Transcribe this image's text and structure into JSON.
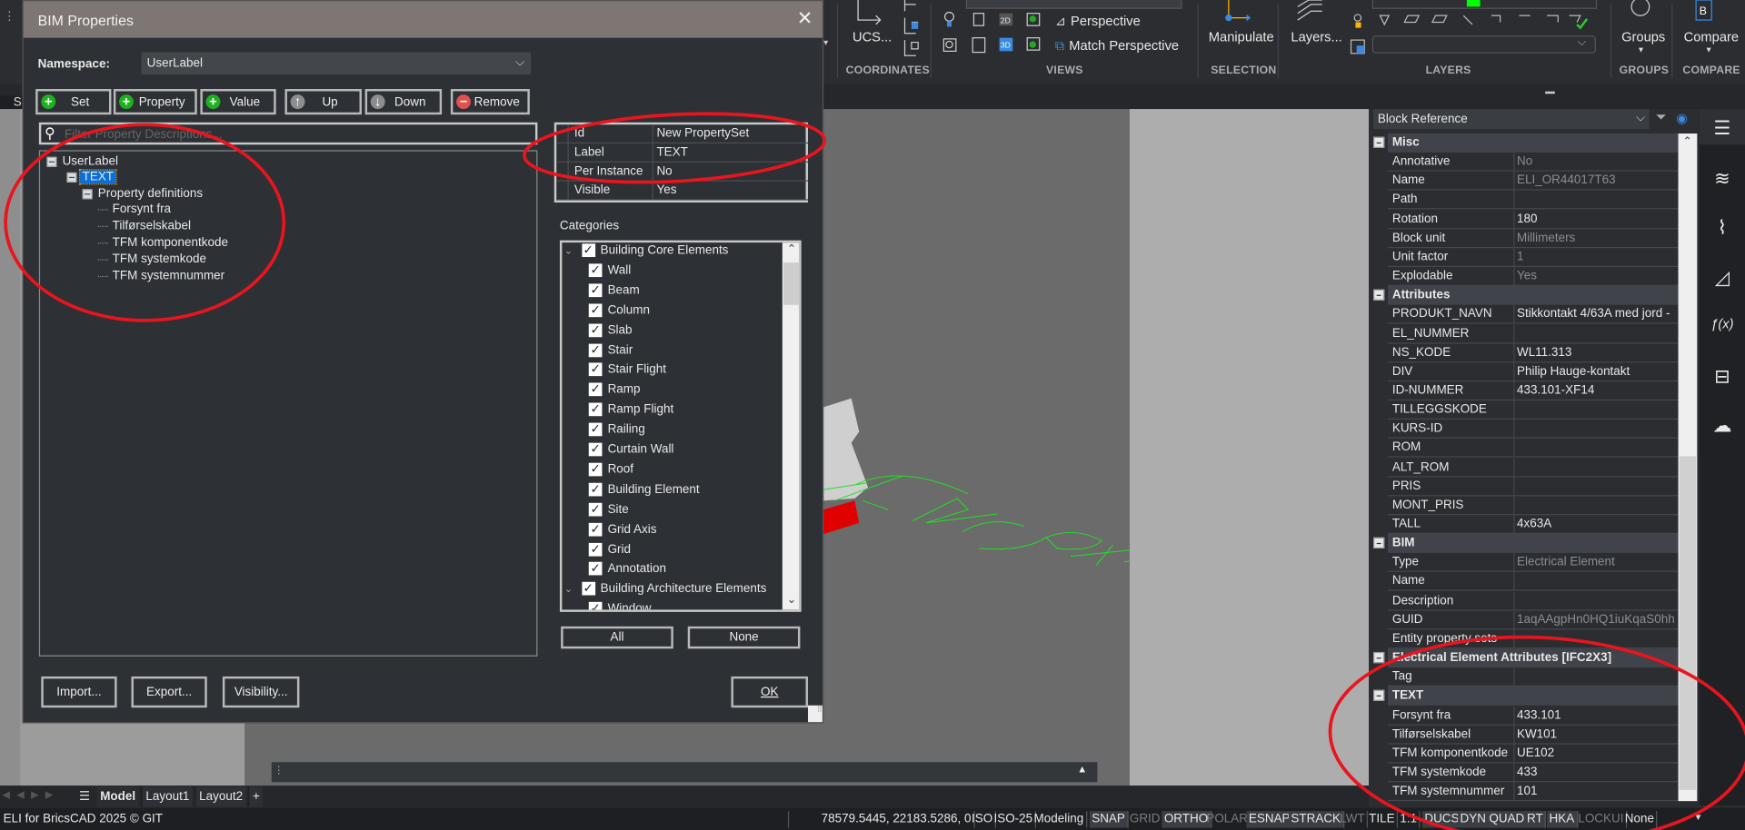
{
  "ribbon": {
    "ucs_label": "UCS...",
    "view_perspective": "Perspective",
    "view_match_perspective": "Match Perspective",
    "manipulate_label": "Manipulate",
    "layers_label": "Layers...",
    "groups_label": "Groups",
    "compare_label": "Compare",
    "sections": [
      "COORDINATES",
      "VIEWS",
      "SELECTION",
      "LAYERS",
      "GROUPS",
      "COMPARE"
    ],
    "layer_color": "#00ff00"
  },
  "dialog": {
    "title": "BIM Properties",
    "namespace_label": "Namespace:",
    "namespace_value": "UserLabel",
    "buttons": [
      {
        "label": "Set",
        "icon": "plus-icon",
        "color": "#1db11d"
      },
      {
        "label": "Property",
        "icon": "plus-icon",
        "color": "#1db11d"
      },
      {
        "label": "Value",
        "icon": "plus-icon",
        "color": "#1db11d"
      },
      {
        "label": "Up",
        "icon": "arrow-up-icon",
        "color": "#8d8d8d"
      },
      {
        "label": "Down",
        "icon": "arrow-down-icon",
        "color": "#8d8d8d"
      },
      {
        "label": "Remove",
        "icon": "minus-icon",
        "color": "#e05050"
      }
    ],
    "filter_placeholder": "Filter Property Descriptions...",
    "tree": {
      "root": "UserLabel",
      "set": "TEXT",
      "group": "Property definitions",
      "items": [
        "Forsynt fra",
        "Tilførselskabel",
        "TFM komponentkode",
        "TFM systemkode",
        "TFM systemnummer"
      ]
    },
    "grid": [
      {
        "name": "Id",
        "value": "New PropertySet"
      },
      {
        "name": "Label",
        "value": "TEXT"
      },
      {
        "name": "Per Instance",
        "value": "No"
      },
      {
        "name": "Visible",
        "value": "Yes"
      }
    ],
    "categories_label": "Categories",
    "categories": [
      {
        "label": "Building Core Elements",
        "group": true
      },
      {
        "label": "Wall"
      },
      {
        "label": "Beam"
      },
      {
        "label": "Column"
      },
      {
        "label": "Slab"
      },
      {
        "label": "Stair"
      },
      {
        "label": "Stair Flight"
      },
      {
        "label": "Ramp"
      },
      {
        "label": "Ramp Flight"
      },
      {
        "label": "Railing"
      },
      {
        "label": "Curtain Wall"
      },
      {
        "label": "Roof"
      },
      {
        "label": "Building Element"
      },
      {
        "label": "Site"
      },
      {
        "label": "Grid Axis"
      },
      {
        "label": "Grid"
      },
      {
        "label": "Annotation"
      },
      {
        "label": "Building Architecture Elements",
        "group": true
      },
      {
        "label": "Window"
      }
    ],
    "all_label": "All",
    "none_label": "None",
    "import_label": "Import...",
    "export_label": "Export...",
    "visibility_label": "Visibility...",
    "ok_label": "OK"
  },
  "properties": {
    "selector": "Block Reference",
    "groups": [
      {
        "title": "Misc",
        "rows": [
          {
            "name": "Annotative",
            "value": "No",
            "dim": true
          },
          {
            "name": "Name",
            "value": "ELI_OR44017T63",
            "dim": true
          },
          {
            "name": "Path",
            "value": ""
          },
          {
            "name": "Rotation",
            "value": "180"
          },
          {
            "name": "Block unit",
            "value": "Millimeters",
            "dim": true
          },
          {
            "name": "Unit factor",
            "value": "1",
            "dim": true
          },
          {
            "name": "Explodable",
            "value": "Yes",
            "dim": true
          }
        ]
      },
      {
        "title": "Attributes",
        "rows": [
          {
            "name": "PRODUKT_NAVN",
            "value": "Stikkontakt 4/63A med jord - "
          },
          {
            "name": "EL_NUMMER",
            "value": ""
          },
          {
            "name": "NS_KODE",
            "value": "WL11.313"
          },
          {
            "name": "DIV",
            "value": "Philip Hauge-kontakt"
          },
          {
            "name": "ID-NUMMER",
            "value": "433.101-XF14"
          },
          {
            "name": "TILLEGGSKODE",
            "value": ""
          },
          {
            "name": "KURS-ID",
            "value": ""
          },
          {
            "name": "ROM",
            "value": ""
          },
          {
            "name": "ALT_ROM",
            "value": ""
          },
          {
            "name": "PRIS",
            "value": ""
          },
          {
            "name": "MONT_PRIS",
            "value": ""
          },
          {
            "name": "TALL",
            "value": "4x63A"
          }
        ]
      },
      {
        "title": "BIM",
        "rows": [
          {
            "name": "Type",
            "value": "Electrical Element",
            "dim": true
          },
          {
            "name": "Name",
            "value": ""
          },
          {
            "name": "Description",
            "value": ""
          },
          {
            "name": "GUID",
            "value": "1aqAAgpHn0HQ1iuKqaS0hh",
            "dim": true
          },
          {
            "name": "Entity property sets",
            "value": ""
          }
        ]
      },
      {
        "title": "Electrical Element Attributes [IFC2X3]",
        "rows": [
          {
            "name": "Tag",
            "value": ""
          }
        ]
      },
      {
        "title": "TEXT",
        "rows": [
          {
            "name": "Forsynt fra",
            "value": "433.101"
          },
          {
            "name": "Tilførselskabel",
            "value": "KW101"
          },
          {
            "name": "TFM komponentkode",
            "value": "UE102"
          },
          {
            "name": "TFM systemkode",
            "value": "433"
          },
          {
            "name": "TFM systemnummer",
            "value": "101"
          }
        ]
      }
    ],
    "side_icons": [
      "sliders-icon",
      "layers-icon",
      "paperclip-icon",
      "drawing-icon",
      "function-icon",
      "hierarchy-icon",
      "cloud-upload-icon"
    ]
  },
  "layout_tabs": [
    "Model",
    "Layout1",
    "Layout2",
    "+"
  ],
  "status": {
    "app": "ELI for BricsCAD 2025 © GIT",
    "coords": "78579.5445, 22183.5286, 0",
    "items": [
      {
        "label": "ISO"
      },
      {
        "label": "ISO-25"
      },
      {
        "label": "Modeling"
      },
      {
        "label": "SNAP",
        "state": "on"
      },
      {
        "label": "GRID",
        "state": "dim"
      },
      {
        "label": "ORTHO",
        "state": "on"
      },
      {
        "label": "POLAR",
        "state": "dim"
      },
      {
        "label": "ESNAP",
        "state": "on"
      },
      {
        "label": "STRACK",
        "state": "on"
      },
      {
        "label": "LWT",
        "state": "dim"
      },
      {
        "label": "TILE"
      },
      {
        "label": "1:1"
      },
      {
        "label": "DUCS",
        "state": "on"
      },
      {
        "label": "DYN",
        "state": "on"
      },
      {
        "label": "QUAD",
        "state": "on"
      },
      {
        "label": "RT",
        "state": "on"
      },
      {
        "label": "HKA",
        "state": "on"
      },
      {
        "label": "LOCKUI",
        "state": "dim"
      },
      {
        "label": "None"
      }
    ]
  },
  "annotation_color": "#e8151f"
}
